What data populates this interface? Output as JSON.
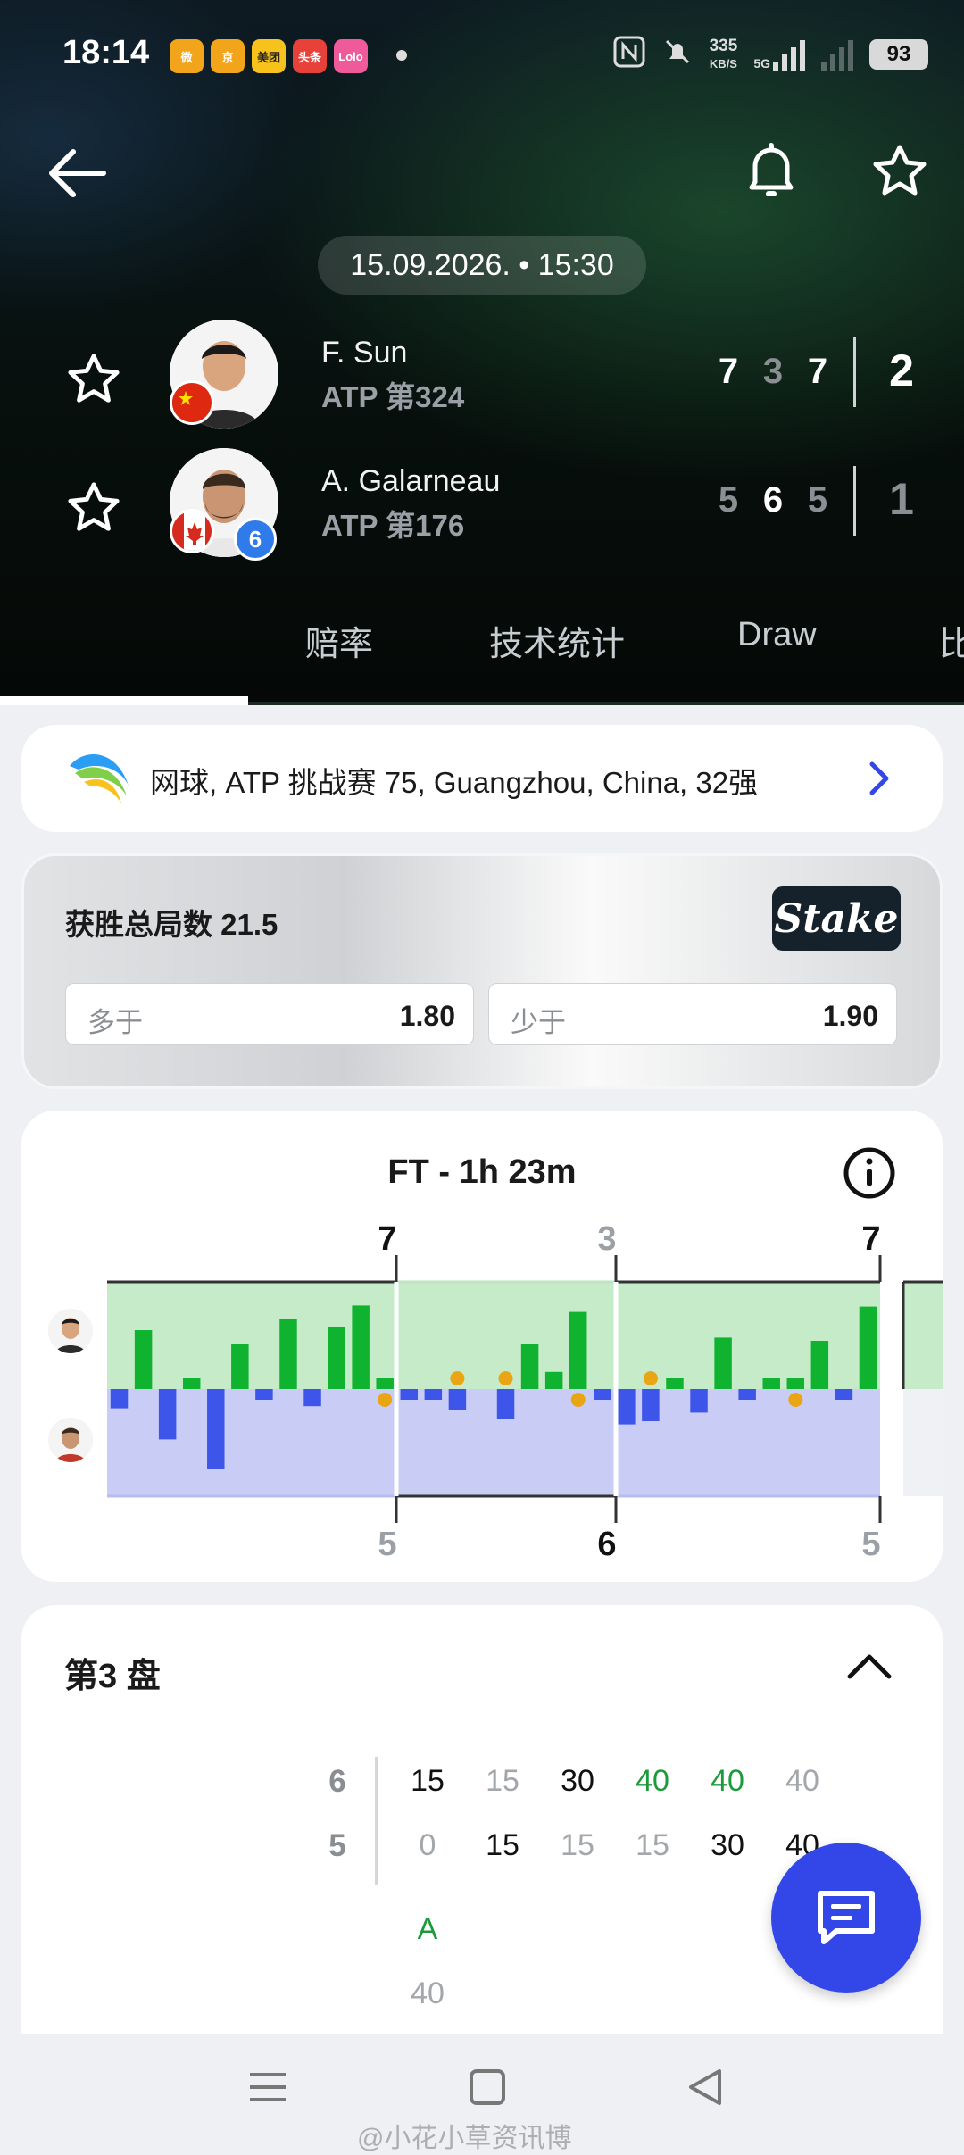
{
  "status_bar": {
    "time": "18:14",
    "apps": [
      {
        "label": "微",
        "color": "#f2a51a"
      },
      {
        "label": "京",
        "color": "#f2a51a"
      },
      {
        "label": "美团",
        "color": "#f7c21b"
      },
      {
        "label": "头条",
        "color": "#e8413a"
      },
      {
        "label": "Lolo",
        "color": "#ee5a9a"
      }
    ],
    "net_speed_top": "335",
    "net_speed_unit": "KB/S",
    "signal_label": "5G",
    "battery": "93"
  },
  "match": {
    "datetime": "15.09.2026. • 15:30",
    "players": [
      {
        "name": "F. Sun",
        "rank": "ATP 第324",
        "sets": [
          "7",
          "3",
          "7"
        ],
        "set_winner": [
          true,
          false,
          true
        ],
        "total": "2",
        "seed": ""
      },
      {
        "name": "A. Galarneau",
        "rank": "ATP 第176",
        "sets": [
          "5",
          "6",
          "5"
        ],
        "set_winner": [
          false,
          true,
          false
        ],
        "total": "1",
        "seed": "6"
      }
    ]
  },
  "tabs": [
    "",
    "赔率",
    "技术统计",
    "Draw",
    "比"
  ],
  "tournament": {
    "text": "网球, ATP 挑战赛 75, Guangzhou, China, 32强"
  },
  "betting": {
    "title": "获胜总局数 21.5",
    "bookmaker": "Stake",
    "over_label": "多于",
    "over_value": "1.80",
    "under_label": "少于",
    "under_value": "1.90"
  },
  "momentum": {
    "title": "FT - 1h 23m",
    "top_set_scores": [
      "7",
      "3",
      "7"
    ],
    "top_set_win": [
      true,
      false,
      true
    ],
    "bottom_set_scores": [
      "5",
      "6",
      "5"
    ],
    "bottom_set_win": [
      false,
      true,
      false
    ],
    "colors": {
      "p1": "#10b330",
      "p2": "#3d55e8",
      "p1_bg": "#c5ebc9",
      "p2_bg": "#c9cdf6",
      "break": "#e9a514"
    }
  },
  "chart_data": {
    "type": "bar",
    "title": "FT - 1h 23m",
    "xlabel": "",
    "ylabel": "",
    "series": [
      {
        "values": [
          0,
          0.55,
          0,
          0.1,
          0,
          0.42,
          0,
          0.65,
          0,
          0.58,
          0.78,
          0.1,
          0,
          0,
          0,
          0,
          0,
          0.42,
          0.16,
          0.72,
          0,
          0,
          0,
          0.1,
          0,
          0.48,
          0,
          0.1,
          0.1,
          0.45,
          0,
          0.77
        ]
      },
      {
        "values": [
          0.18,
          0,
          0.47,
          0,
          0.75,
          0,
          0.1,
          0,
          0.16,
          0,
          0,
          0,
          0.1,
          0.1,
          0.2,
          0,
          0.28,
          0,
          0,
          0,
          0.1,
          0.33,
          0.3,
          0,
          0.22,
          0,
          0.1,
          0,
          0,
          0,
          0.1,
          0
        ]
      }
    ]
  },
  "set3": {
    "title": "第3 盘",
    "p1_games": "6",
    "p2_games": "5",
    "p1_points": [
      "15",
      "15",
      "30",
      "40",
      "40",
      "40"
    ],
    "p1_point_style": [
      "k",
      "g",
      "k",
      "w",
      "w",
      "g"
    ],
    "p2_points": [
      "0",
      "15",
      "15",
      "15",
      "30",
      "40"
    ],
    "p2_point_style": [
      "g",
      "k",
      "g",
      "g",
      "k",
      "k"
    ],
    "extra_top": "A",
    "extra_bottom": "40"
  },
  "watermark": "@小花小草资讯博"
}
